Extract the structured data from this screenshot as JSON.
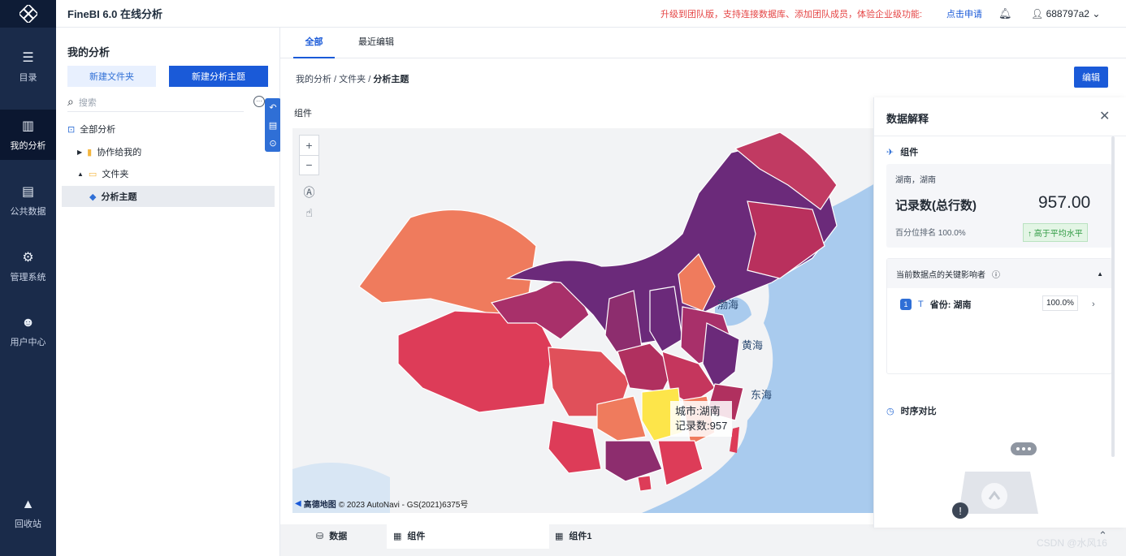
{
  "app": {
    "title": "FineBI 6.0 在线分析",
    "promo": "升级到团队版，支持连接数据库、添加团队成员，体验企业级功能:",
    "apply_link": "点击申请",
    "user": "688797a2"
  },
  "nav": [
    {
      "label": "目录",
      "icon": "catalog-icon"
    },
    {
      "label": "我的分析",
      "icon": "analysis-icon",
      "active": true
    },
    {
      "label": "公共数据",
      "icon": "public-data-icon"
    },
    {
      "label": "管理系统",
      "icon": "admin-icon"
    },
    {
      "label": "用户中心",
      "icon": "user-center-icon"
    },
    {
      "label": "回收站",
      "icon": "recycle-icon"
    }
  ],
  "left": {
    "title": "我的分析",
    "new_folder": "新建文件夹",
    "new_subject": "新建分析主题",
    "search_placeholder": "搜索",
    "tree": [
      {
        "label": "全部分析"
      },
      {
        "label": "协作给我的"
      },
      {
        "label": "文件夹"
      },
      {
        "label": "分析主题",
        "selected": true
      }
    ]
  },
  "main": {
    "tabs": [
      "全部",
      "最近编辑"
    ],
    "breadcrumb": [
      "我的分析",
      "文件夹",
      "分析主题"
    ],
    "edit_button": "编辑",
    "component_title": "组件",
    "tooltip": {
      "line1": "城市:湖南",
      "line2": "记录数:957"
    },
    "seas": [
      "渤海",
      "黄海",
      "东海"
    ],
    "attribution": {
      "brand": "高德地图",
      "text": "© 2023 AutoNavi - GS(2021)6375号"
    },
    "bottom_tabs": [
      "数据",
      "组件",
      "组件1"
    ]
  },
  "panel": {
    "title": "数据解释",
    "component": "组件",
    "location": "湖南，湖南",
    "metric_label": "记录数(总行数)",
    "metric_value": "957.00",
    "percentile": "百分位排名 100.0%",
    "badge": "高于平均水平",
    "factors_title": "当前数据点的关键影响者",
    "factor_rank": "1",
    "factor_label": "省份: 湖南",
    "factor_value": "100.0%",
    "timing_title": "时序对比"
  },
  "watermark": "CSDN @水风16",
  "colors": {
    "accent": "#1a5ad8",
    "nav_bg": "#1a2b4a",
    "highlight": "#fde54a",
    "promo": "#e54545"
  }
}
